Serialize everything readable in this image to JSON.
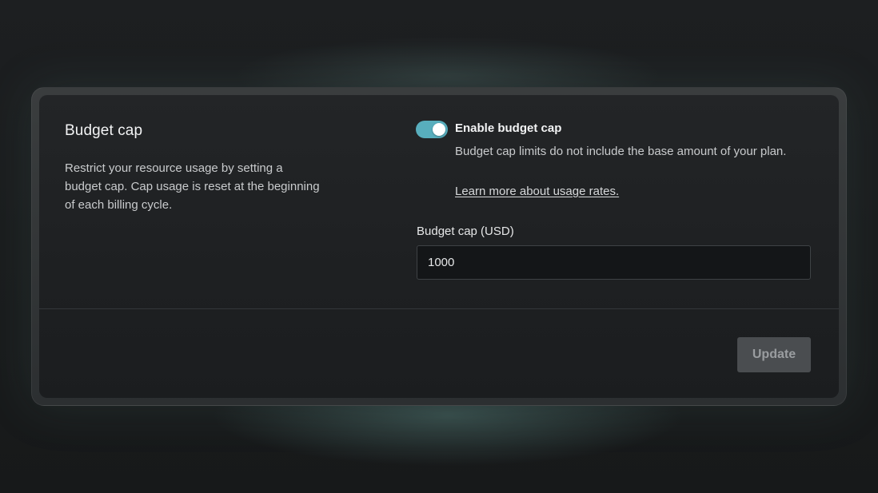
{
  "settings": {
    "title": "Budget cap",
    "description": "Restrict your resource usage by setting a budget cap. Cap usage is reset at the beginning of each billing cycle.",
    "toggle": {
      "label": "Enable budget cap",
      "enabled": true,
      "help": "Budget cap limits do not include the base amount of your plan.",
      "link_text": "Learn more about usage rates."
    },
    "field": {
      "label": "Budget cap (USD)",
      "value": "1000"
    },
    "update_label": "Update"
  },
  "colors": {
    "toggle_on": "#58aebd",
    "button_disabled_bg": "#4a4d50",
    "button_disabled_text": "#9a9da0",
    "card_bg": "#1e2022",
    "page_bg": "#1a1c1d"
  }
}
